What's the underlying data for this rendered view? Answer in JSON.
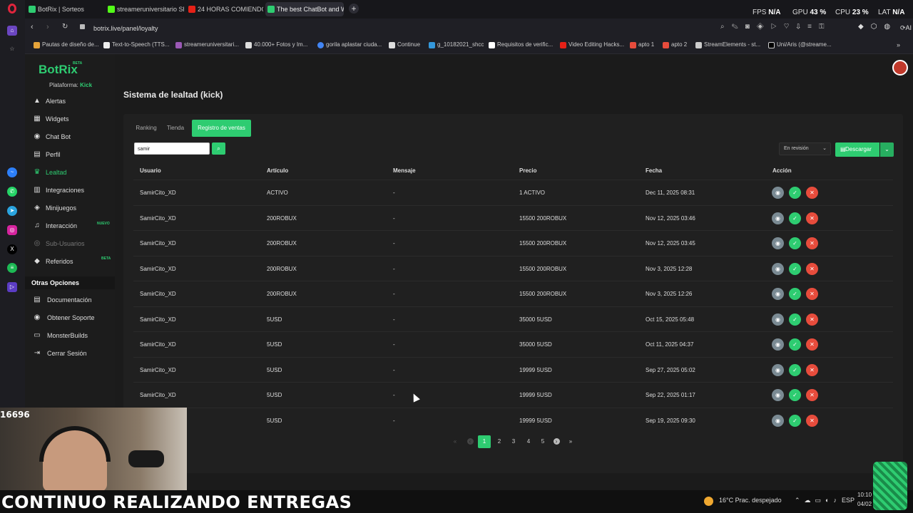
{
  "browser": {
    "tabs": [
      {
        "title": "BotRix | Sorteos",
        "active": false
      },
      {
        "title": "streameruniversitario Sho",
        "active": false
      },
      {
        "title": "24 HORAS COMIENDO en",
        "active": false
      },
      {
        "title": "The best ChatBot and Wi",
        "active": true
      }
    ],
    "add_tab": "+",
    "url": "botrix.live/panel/loyalty",
    "stats": {
      "fps_label": "FPS",
      "fps": "N/A",
      "gpu_label": "GPU",
      "gpu": "43 %",
      "cpu_label": "CPU",
      "cpu": "23 %",
      "lat_label": "LAT",
      "lat": "N/A"
    },
    "ai_label": "AI",
    "bookmarks": [
      "Pautas de diseño de...",
      "Text-to-Speech (TTS...",
      "streameruniversitari...",
      "40.000+ Fotos y Im...",
      "gorila aplastar ciuda...",
      "Continue",
      "g_10182021_shcc",
      "Requisitos de verific...",
      "Video Editing Hacks...",
      "apto 1",
      "apto 2",
      "StreamElements - st...",
      "Uni/Aris (@streame..."
    ]
  },
  "sidebar": {
    "logo": "BotRix",
    "beta": "BETA",
    "platform_label": "Plataforma:",
    "platform_value": "Kick",
    "items": [
      {
        "label": "Alertas",
        "icon": "warning-icon",
        "glyph": "▲"
      },
      {
        "label": "Widgets",
        "icon": "widgets-icon",
        "glyph": "▦"
      },
      {
        "label": "Chat Bot",
        "icon": "robot-icon",
        "glyph": "◉"
      },
      {
        "label": "Perfil",
        "icon": "profile-icon",
        "glyph": "▤"
      },
      {
        "label": "Lealtad",
        "icon": "trophy-icon",
        "glyph": "♛"
      },
      {
        "label": "Integraciones",
        "icon": "integrations-icon",
        "glyph": "▥"
      },
      {
        "label": "Minijuegos",
        "icon": "gamepad-icon",
        "glyph": "◈"
      },
      {
        "label": "Interacción",
        "icon": "music-icon",
        "glyph": "♫"
      },
      {
        "label": "Sub-Usuarios",
        "icon": "users-icon",
        "glyph": "◎"
      },
      {
        "label": "Referidos",
        "icon": "referrals-icon",
        "glyph": "◆"
      }
    ],
    "nuevo_tag": "NUEVO",
    "beta_tag": "BETA",
    "section_title": "Otras Opciones",
    "other_items": [
      {
        "label": "Documentación",
        "icon": "book-icon",
        "glyph": "▤"
      },
      {
        "label": "Obtener Soporte",
        "icon": "support-icon",
        "glyph": "◉"
      },
      {
        "label": "MonsterBuilds",
        "icon": "monitor-icon",
        "glyph": "▭"
      },
      {
        "label": "Cerrar Sesión",
        "icon": "logout-icon",
        "glyph": "⇥"
      }
    ]
  },
  "page": {
    "title": "Sistema de lealtad (kick)",
    "tabs": [
      "Ranking",
      "Tienda",
      "Registro de ventas"
    ],
    "search_value": "samir",
    "filter_value": "En revisión",
    "download_label": "Descargar",
    "columns": [
      "Usuario",
      "Artículo",
      "Mensaje",
      "Precio",
      "Fecha",
      "Acción"
    ],
    "rows": [
      {
        "user": "SamirCito_XD",
        "item": "ACTIVO",
        "msg": "-",
        "price": "1 ACTIVO",
        "date": "Dec 11, 2025 08:31"
      },
      {
        "user": "SamirCito_XD",
        "item": "200ROBUX",
        "msg": "-",
        "price": "15500 200ROBUX",
        "date": "Nov 12, 2025 03:46"
      },
      {
        "user": "SamirCito_XD",
        "item": "200ROBUX",
        "msg": "-",
        "price": "15500 200ROBUX",
        "date": "Nov 12, 2025 03:45"
      },
      {
        "user": "SamirCito_XD",
        "item": "200ROBUX",
        "msg": "-",
        "price": "15500 200ROBUX",
        "date": "Nov 3, 2025 12:28"
      },
      {
        "user": "SamirCito_XD",
        "item": "200ROBUX",
        "msg": "-",
        "price": "15500 200ROBUX",
        "date": "Nov 3, 2025 12:26"
      },
      {
        "user": "SamirCito_XD",
        "item": "5USD",
        "msg": "-",
        "price": "35000 5USD",
        "date": "Oct 15, 2025 05:48"
      },
      {
        "user": "SamirCito_XD",
        "item": "5USD",
        "msg": "-",
        "price": "35000 5USD",
        "date": "Oct 11, 2025 04:37"
      },
      {
        "user": "SamirCito_XD",
        "item": "5USD",
        "msg": "-",
        "price": "19999 5USD",
        "date": "Sep 27, 2025 05:02"
      },
      {
        "user": "SamirCito_XD",
        "item": "5USD",
        "msg": "-",
        "price": "19999 5USD",
        "date": "Sep 22, 2025 01:17"
      },
      {
        "user": "",
        "item": "5USD",
        "msg": "-",
        "price": "19999 5USD",
        "date": "Sep 19, 2025 09:30"
      }
    ],
    "pagination": {
      "first": "«",
      "prev": "‹",
      "pages": [
        "1",
        "2",
        "3",
        "4",
        "5"
      ],
      "current": "1",
      "next": "›",
      "last": "»"
    }
  },
  "overlay": {
    "viewer_count": "16696",
    "caption": "CONTINUO REALIZANDO ENTREGAS",
    "weather": "16°C  Prac. despejado",
    "lang": "ESP",
    "time": "10:10",
    "date": "04/02"
  },
  "colors": {
    "accent": "#2ecc71",
    "danger": "#e74c3c",
    "view": "#7a8a93"
  }
}
